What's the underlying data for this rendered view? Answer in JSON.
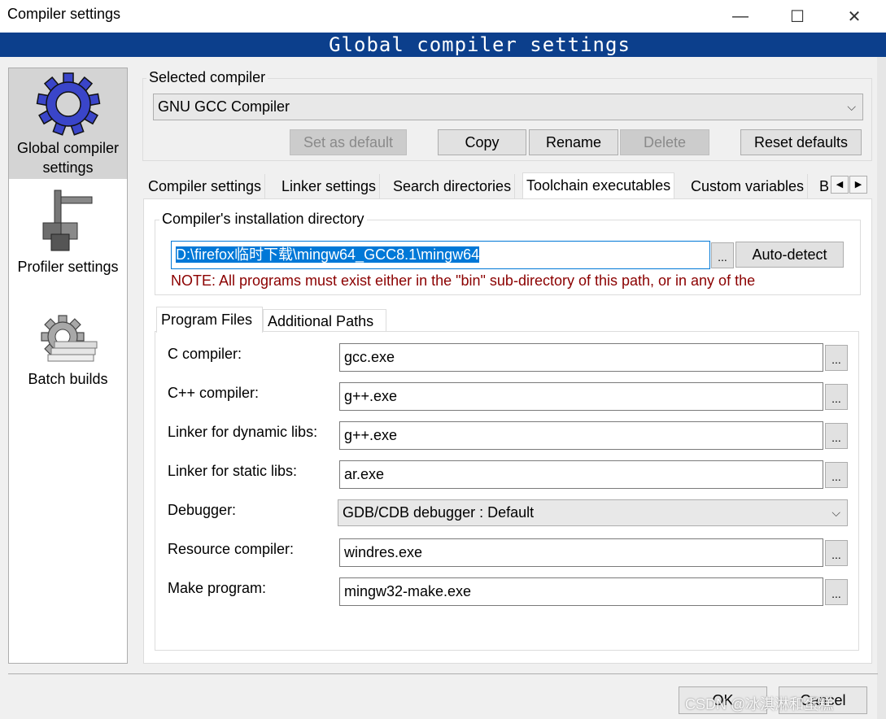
{
  "window": {
    "title": "Compiler settings",
    "minimize_glyph": "—",
    "maximize_glyph": "☐",
    "close_glyph": "✕"
  },
  "banner": "Global  compiler  settings",
  "nav": [
    {
      "label": "Global compiler settings",
      "icon": "gear-icon"
    },
    {
      "label": "Profiler settings",
      "icon": "profiler-icon"
    },
    {
      "label": "Batch builds",
      "icon": "batch-gear-icon"
    }
  ],
  "selected_compiler": {
    "group_label": "Selected compiler",
    "value": "GNU GCC Compiler",
    "buttons": {
      "set_default": "Set as default",
      "copy": "Copy",
      "rename": "Rename",
      "delete": "Delete",
      "reset": "Reset defaults"
    }
  },
  "tabs": [
    "Compiler settings",
    "Linker settings",
    "Search directories",
    "Toolchain executables",
    "Custom variables",
    "B"
  ],
  "active_tab": "Toolchain executables",
  "install_dir": {
    "group_label": "Compiler's installation directory",
    "value": "D:\\firefox临时下载\\mingw64_GCC8.1\\mingw64",
    "browse": "...",
    "autodetect": "Auto-detect",
    "note": "NOTE: All programs must exist either in the \"bin\" sub-directory of this path, or in any of the"
  },
  "subtabs": [
    "Program Files",
    "Additional Paths"
  ],
  "programs": [
    {
      "label": "C compiler:",
      "value": "gcc.exe"
    },
    {
      "label": "C++ compiler:",
      "value": "g++.exe"
    },
    {
      "label": "Linker for dynamic libs:",
      "value": "g++.exe"
    },
    {
      "label": "Linker for static libs:",
      "value": "ar.exe"
    },
    {
      "label": "Debugger:",
      "value": "GDB/CDB debugger : Default"
    },
    {
      "label": "Resource compiler:",
      "value": "windres.exe"
    },
    {
      "label": "Make program:",
      "value": "mingw32-make.exe"
    }
  ],
  "dots": "...",
  "footer": {
    "ok": "OK",
    "cancel": "Cancel",
    "watermark": "CSDN @冰淇淋和蛋糕"
  },
  "colors": {
    "banner_bg": "#0c3f8c",
    "note_text": "#8b0000",
    "selection": "#0078d7"
  }
}
